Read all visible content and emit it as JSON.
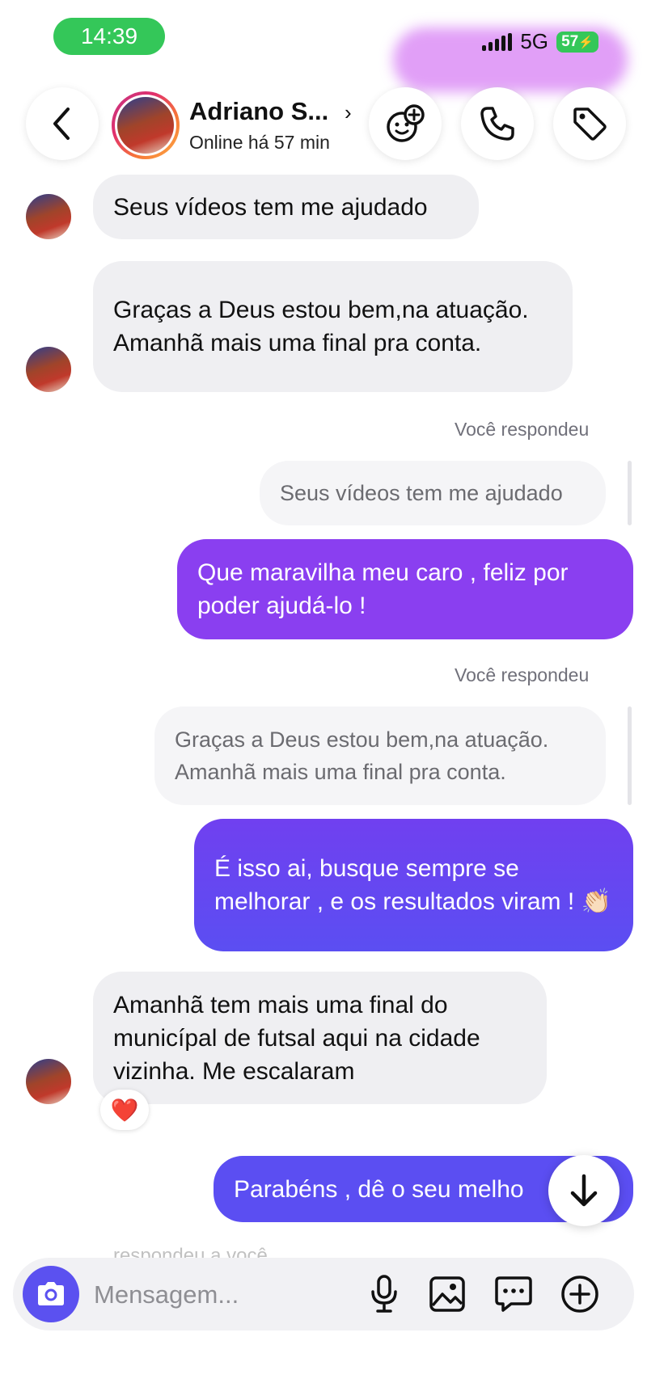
{
  "status_bar": {
    "time": "14:39",
    "network": "5G",
    "battery": "57"
  },
  "header": {
    "name": "Adriano S...",
    "status": "Online há 57 min",
    "chevron": "›"
  },
  "messages": {
    "m1": "Seus vídeos tem me ajudado",
    "m2": "Graças a Deus estou bem,na atuação. Amanhã mais uma final pra conta.",
    "reply1_label": "Você respondeu",
    "reply1_quote": "Seus vídeos tem me ajudado",
    "out1": "Que maravilha meu caro , feliz por poder ajudá-lo !",
    "reply2_label": "Você respondeu",
    "reply2_quote": "Graças a Deus estou bem,na atuação. Amanhã mais uma final pra conta.",
    "out2": "É isso ai, busque sempre se melhorar , e os resultados viram ! 👏🏻",
    "m3": "Amanhã tem mais uma final do municípal de futsal aqui na cidade vizinha. Me escalaram",
    "m3_reaction": "❤️",
    "out3": "Parabéns , dê o seu melho",
    "faded": "respondeu a você"
  },
  "composer": {
    "placeholder": "Mensagem..."
  },
  "icons": {
    "back": "chevron-left-icon",
    "sticker": "sticker-add-icon",
    "call": "phone-icon",
    "tag": "tag-icon",
    "scroll": "arrow-down-icon",
    "camera": "camera-icon",
    "mic": "microphone-icon",
    "gallery": "image-icon",
    "chat": "chat-bubble-icon",
    "plus": "plus-circle-icon"
  },
  "colors": {
    "accent": "#5b51f0",
    "gradient_start": "#8a3ff0",
    "gradient_end": "#5b4ef2",
    "time_pill": "#34c759"
  }
}
